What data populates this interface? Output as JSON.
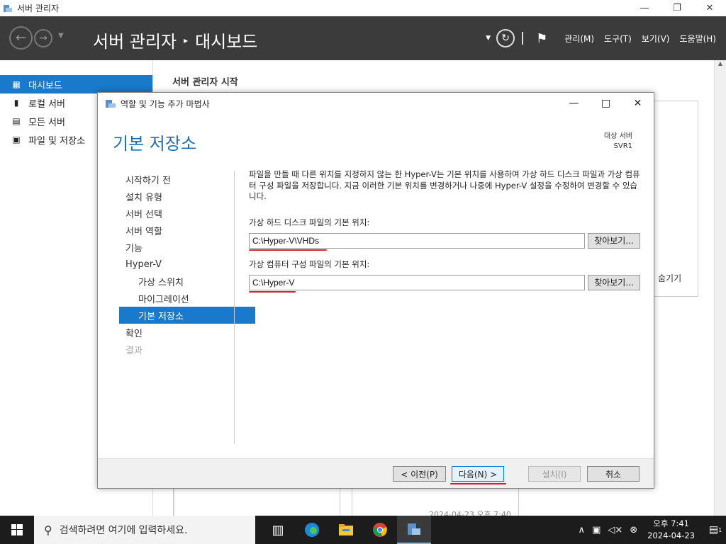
{
  "window": {
    "title": "서버 관리자",
    "controls": {
      "minimize": "—",
      "restore": "❐",
      "close": "✕"
    }
  },
  "header": {
    "breadcrumb_root": "서버 관리자",
    "breadcrumb_separator": "▸",
    "breadcrumb_page": "대시보드",
    "menus": [
      "관리(M)",
      "도구(T)",
      "보기(V)",
      "도움말(H)"
    ],
    "icons": [
      "back-icon",
      "forward-icon",
      "refresh-icon",
      "flag-icon"
    ]
  },
  "sidebar": {
    "items": [
      {
        "label": "대시보드",
        "icon": "dashboard-icon",
        "active": true
      },
      {
        "label": "로컬 서버",
        "icon": "server-icon",
        "active": false
      },
      {
        "label": "모든 서버",
        "icon": "servers-icon",
        "active": false
      },
      {
        "label": "파일 및 저장소",
        "icon": "storage-icon",
        "active": false
      }
    ]
  },
  "main": {
    "start_title": "서버 관리자 시작",
    "hide_label": "숨기기",
    "timestamp": "2024-04-23 오후 7:40"
  },
  "wizard": {
    "title": "역할 및 기능 추가 마법사",
    "heading": "기본 저장소",
    "target_label": "대상 서버",
    "target_value": "SVR1",
    "steps": [
      {
        "label": "시작하기 전",
        "state": "normal"
      },
      {
        "label": "설치 유형",
        "state": "normal"
      },
      {
        "label": "서버 선택",
        "state": "normal"
      },
      {
        "label": "서버 역할",
        "state": "normal"
      },
      {
        "label": "기능",
        "state": "normal"
      },
      {
        "label": "Hyper-V",
        "state": "normal"
      },
      {
        "label": "가상 스위치",
        "state": "sub"
      },
      {
        "label": "마이그레이션",
        "state": "sub"
      },
      {
        "label": "기본 저장소",
        "state": "active"
      },
      {
        "label": "확인",
        "state": "normal"
      },
      {
        "label": "결과",
        "state": "disabled"
      }
    ],
    "description": "파일을 만들 때 다른 위치를 지정하지 않는 한 Hyper-V는 기본 위치를 사용하여 가상 하드 디스크 파일과 가상 컴퓨터 구성 파일을 저장합니다. 지금 이러한 기본 위치를 변경하거나 나중에 Hyper-V 설정을 수정하여 변경할 수 있습니다.",
    "vhd_label": "가상 하드 디스크 파일의 기본 위치:",
    "vhd_value": "C:\\Hyper-V\\VHDs",
    "vm_label": "가상 컴퓨터 구성 파일의 기본 위치:",
    "vm_value": "C:\\Hyper-V",
    "browse_label": "찾아보기...",
    "buttons": {
      "previous": "< 이전(P)",
      "next": "다음(N) >",
      "install": "설치(I)",
      "cancel": "취소"
    },
    "highlight_color": "#d81e2a"
  },
  "taskbar": {
    "search_placeholder": "검색하려면 여기에 입력하세요.",
    "apps": [
      "task-view-icon",
      "edge-icon",
      "file-explorer-icon",
      "chrome-icon",
      "server-manager-icon"
    ],
    "time": "오후 7:41",
    "date": "2024-04-23",
    "notification_count": "1"
  },
  "colors": {
    "accent": "#1979ca",
    "header_bg": "#3b3b3b",
    "heading": "#1e6fb5"
  }
}
